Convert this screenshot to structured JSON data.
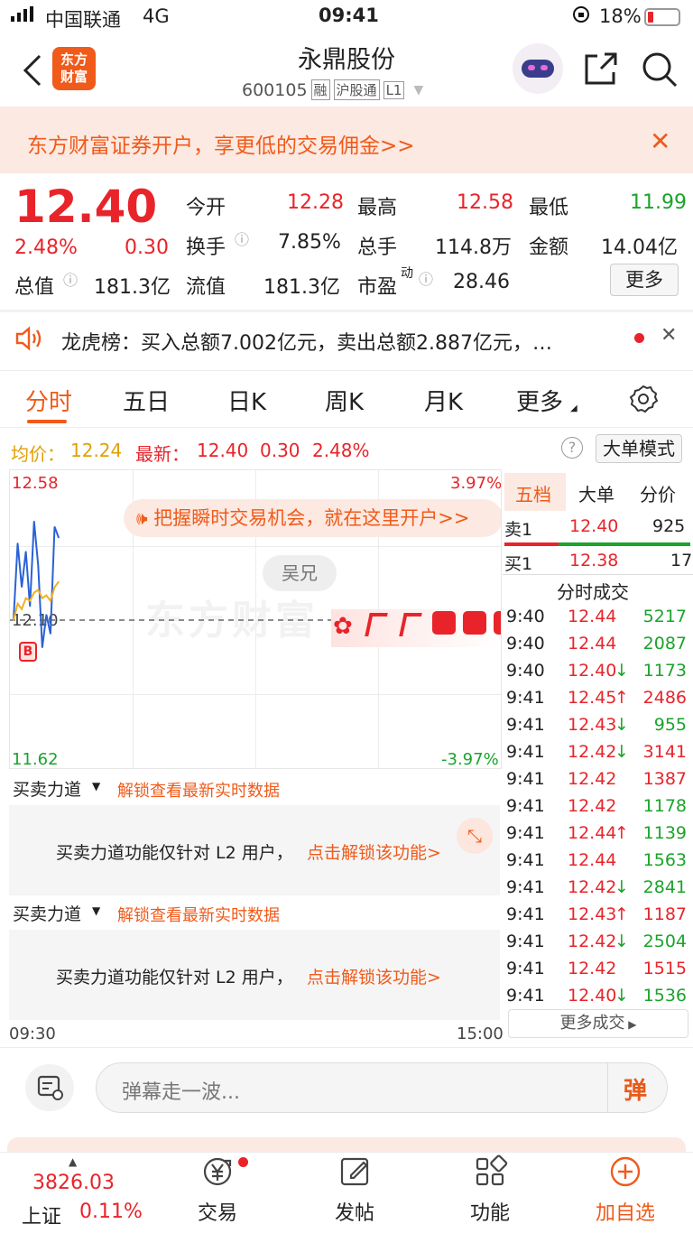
{
  "status_bar": {
    "carrier": "中国联通",
    "network": "4G",
    "time": "09:41",
    "battery": "18%"
  },
  "header": {
    "logo_text": "东方\n财富",
    "title": "永鼎股份",
    "code": "600105",
    "badges": [
      "融",
      "沪股通",
      "L1"
    ],
    "share_icon": "share-icon",
    "search_icon": "search-icon"
  },
  "promo": {
    "text": "东方财富证券开户，享更低的交易佣金>>"
  },
  "quote": {
    "price": "12.40",
    "change_pct": "2.48%",
    "change": "0.30",
    "total_value_label": "总值",
    "total_value": "181.3亿",
    "stats": [
      {
        "label": "今开",
        "value": "12.28",
        "color": "red"
      },
      {
        "label": "最高",
        "value": "12.58",
        "color": "red"
      },
      {
        "label": "最低",
        "value": "11.99",
        "color": "green"
      },
      {
        "label": "换手",
        "value": "7.85%",
        "color": "dark"
      },
      {
        "label": "总手",
        "value": "114.8万",
        "color": "dark"
      },
      {
        "label": "金额",
        "value": "14.04亿",
        "color": "dark"
      },
      {
        "label": "流值",
        "value": "181.3亿",
        "color": "dark"
      },
      {
        "label": "市盈",
        "value": "28.46",
        "color": "dark"
      }
    ],
    "pe_superscript": "动",
    "more_button": "更多"
  },
  "longhubang": {
    "text": "龙虎榜：买入总额7.002亿元，卖出总额2.887亿元，…"
  },
  "tabs": [
    "分时",
    "五日",
    "日K",
    "周K",
    "月K",
    "更多"
  ],
  "active_tab": "分时",
  "info_line": {
    "avg_label": "均价：",
    "avg_value": "12.24",
    "latest_label": "最新：",
    "latest_value": "12.40",
    "latest_change": "0.30",
    "latest_pct": "2.48%",
    "mode_button": "大单模式"
  },
  "chart": {
    "y_max": "12.58",
    "y_min": "11.62",
    "mid_price": "12.10",
    "pct_top": "3.97%",
    "pct_bottom": "-3.97%",
    "watermark": "东方财富",
    "banner": "把握瞬时交易机会，就在这里开户>>",
    "user_tag": "吴兄",
    "buy_marker": "B",
    "time_start": "09:30",
    "time_end": "15:00"
  },
  "chart_data": {
    "type": "line",
    "title": "",
    "x": [
      "09:30",
      "09:31",
      "09:32",
      "09:33",
      "09:34",
      "09:35",
      "09:36",
      "09:37",
      "09:38",
      "09:39",
      "09:40",
      "09:41"
    ],
    "series": [
      {
        "name": "",
        "values": [
          12.1,
          12.38,
          12.22,
          12.35,
          12.15,
          12.46,
          12.3,
          12.0,
          12.12,
          12.05,
          12.44,
          12.4
        ]
      },
      {
        "name": "均价",
        "values": [
          12.1,
          12.16,
          12.14,
          12.18,
          12.17,
          12.2,
          12.21,
          12.18,
          12.19,
          12.17,
          12.22,
          12.24
        ]
      }
    ],
    "xlabel": "",
    "ylabel": "",
    "ylim": [
      11.62,
      12.58
    ],
    "reference_line": 12.1
  },
  "right_panel": {
    "tabs": [
      "五档",
      "大单",
      "分价"
    ],
    "active_tab": "五档",
    "sell1": {
      "label": "卖1",
      "price": "12.40",
      "volume": "925"
    },
    "buy1": {
      "label": "买1",
      "price": "12.38",
      "volume": "17"
    },
    "trades_title": "分时成交",
    "trades": [
      {
        "time": "9:40",
        "price": "12.44",
        "arrow": "",
        "volume": "5217",
        "pcolor": "red",
        "vcolor": "green"
      },
      {
        "time": "9:40",
        "price": "12.44",
        "arrow": "",
        "volume": "2087",
        "pcolor": "red",
        "vcolor": "green"
      },
      {
        "time": "9:40",
        "price": "12.40",
        "arrow": "↓",
        "volume": "1173",
        "pcolor": "red",
        "vcolor": "green"
      },
      {
        "time": "9:41",
        "price": "12.45",
        "arrow": "↑",
        "volume": "2486",
        "pcolor": "red",
        "vcolor": "red"
      },
      {
        "time": "9:41",
        "price": "12.43",
        "arrow": "↓",
        "volume": "955",
        "pcolor": "red",
        "vcolor": "green"
      },
      {
        "time": "9:41",
        "price": "12.42",
        "arrow": "↓",
        "volume": "3141",
        "pcolor": "red",
        "vcolor": "red"
      },
      {
        "time": "9:41",
        "price": "12.42",
        "arrow": "",
        "volume": "1387",
        "pcolor": "red",
        "vcolor": "red"
      },
      {
        "time": "9:41",
        "price": "12.42",
        "arrow": "",
        "volume": "1178",
        "pcolor": "red",
        "vcolor": "green"
      },
      {
        "time": "9:41",
        "price": "12.44",
        "arrow": "↑",
        "volume": "1139",
        "pcolor": "red",
        "vcolor": "green"
      },
      {
        "time": "9:41",
        "price": "12.44",
        "arrow": "",
        "volume": "1563",
        "pcolor": "red",
        "vcolor": "green"
      },
      {
        "time": "9:41",
        "price": "12.42",
        "arrow": "↓",
        "volume": "2841",
        "pcolor": "red",
        "vcolor": "green"
      },
      {
        "time": "9:41",
        "price": "12.43",
        "arrow": "↑",
        "volume": "1187",
        "pcolor": "red",
        "vcolor": "red"
      },
      {
        "time": "9:41",
        "price": "12.42",
        "arrow": "↓",
        "volume": "2504",
        "pcolor": "red",
        "vcolor": "green"
      },
      {
        "time": "9:41",
        "price": "12.42",
        "arrow": "",
        "volume": "1515",
        "pcolor": "red",
        "vcolor": "red"
      },
      {
        "time": "9:41",
        "price": "12.40",
        "arrow": "↓",
        "volume": "1536",
        "pcolor": "red",
        "vcolor": "green"
      }
    ],
    "more_trades": "更多成交"
  },
  "power": {
    "title": "买卖力道",
    "unlock_link": "解锁查看最新实时数据",
    "box_text": "买卖力道功能仅针对 L2 用户，",
    "box_link": "点击解锁该功能>"
  },
  "danmu": {
    "placeholder": "弹幕走一波...",
    "button": "弹"
  },
  "bottom_nav": {
    "index_value": "3826.03",
    "index_name": "上证",
    "index_change": "0.11%",
    "items": [
      "交易",
      "发帖",
      "功能",
      "加自选"
    ]
  }
}
